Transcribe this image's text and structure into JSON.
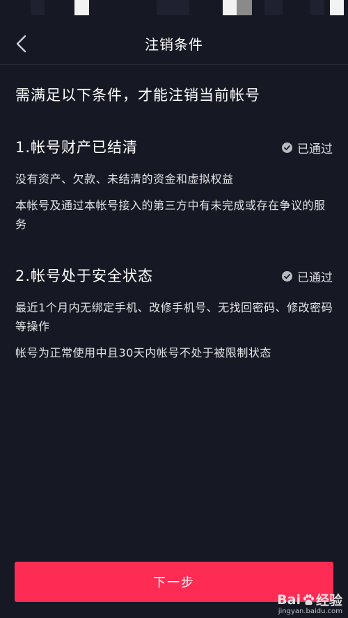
{
  "header": {
    "title": "注销条件"
  },
  "intro": "需满足以下条件，才能注销当前帐号",
  "sections": [
    {
      "title": "1.帐号财产已结清",
      "status": "已通过",
      "items": [
        "没有资产、欠款、未结清的资金和虚拟权益",
        "本帐号及通过本帐号接入的第三方中有未完成或存在争议的服务"
      ]
    },
    {
      "title": "2.帐号处于安全状态",
      "status": "已通过",
      "items": [
        "最近1个月内无绑定手机、改修手机号、无找回密码、修改密码等操作",
        "帐号为正常使用中且30天内帐号不处于被限制状态"
      ]
    }
  ],
  "footer": {
    "next_label": "下一步"
  },
  "watermark": {
    "brand_left": "Bai",
    "brand_right": "经验",
    "url": "jingyan.baidu.com"
  },
  "colors": {
    "background": "#161823",
    "accent": "#fe2c55"
  }
}
